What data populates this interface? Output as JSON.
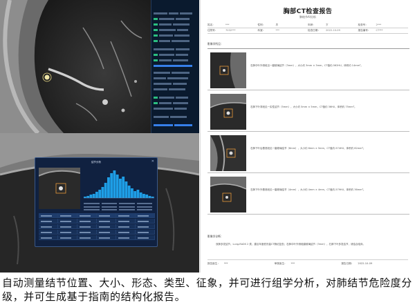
{
  "modal": {
    "title": "结节分析",
    "close_icon": "close-icon"
  },
  "report": {
    "title": "胸部CT检查报告",
    "subtitle": "肺结节AI分析",
    "info_rows": [
      [
        {
          "label": "姓名：",
          "value": "***"
        },
        {
          "label": "性别：",
          "value": "男"
        },
        {
          "label": "年龄：",
          "value": "岁"
        },
        {
          "label": "检查号：",
          "value": "2***"
        }
      ],
      [
        {
          "label": "住院号：",
          "value": "7032***"
        },
        {
          "label": "科室：",
          "value": "***"
        },
        {
          "label": "检查日期：",
          "value": "2022-10-09"
        },
        {
          "label": "报告编号：",
          "value": "CT***"
        }
      ]
    ],
    "section_label": "影像学所见：",
    "findings": [
      "右肺中叶外侧段见一磨玻璃结节（3mm），大小约 3mm × 3mm，CT值约-562HU，体积约 14mm³。",
      "右肺下叶背段见一实性结节（5mm），大小约 5mm × 5mm，CT值约 36HU，体积约 75mm³。",
      "右肺下叶后基底段见一磨玻璃结节（6mm），大小约 6mm × 5mm，CT值约-574HU，体积约 82mm³。",
      "右肺下叶外基底段见一磨玻璃结节（4mm），大小约 4mm × 4mm，CT值约-579HU，体积约 36mm³。"
    ],
    "conclusion_label": "影像学诊断：",
    "conclusion_text": "双肺多发结节，Lung-RADS 2 类，建议年度低剂量CT随访复查；右肺中叶外侧段磨玻璃结节（3mm），右肺下叶多发结节，请结合临床。",
    "footer": [
      {
        "label": "报告医生：",
        "value": "***"
      },
      {
        "label": "审核医生：",
        "value": "***"
      },
      {
        "label": "报告日期：",
        "value": "2022-10-09"
      }
    ]
  },
  "caption": "自动测量结节位置、大小、形态、类型、征象，并可进行组学分析，对肺结节危险度分级，并可生成基于指南的结构化报告。",
  "colors": {
    "panel_bg": "#0a1a2e",
    "modal_bg": "#102140",
    "histogram_bar": "#1e9ee6",
    "accent_green": "#2fd18a",
    "report_text": "#444444"
  }
}
